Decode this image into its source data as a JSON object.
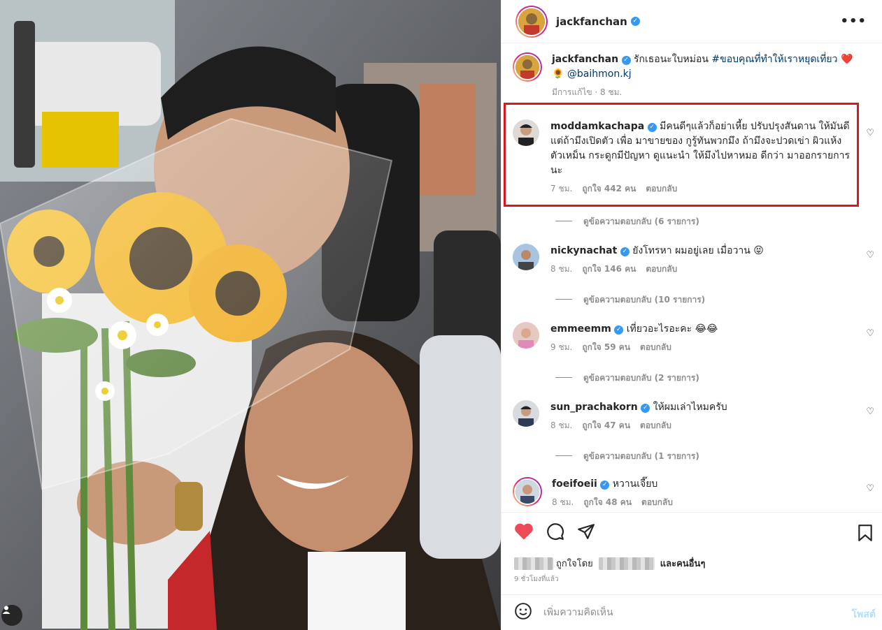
{
  "post": {
    "username": "jackfanchan",
    "caption_user": "jackfanchan",
    "caption_text": "รักเธอนะใบหม่อน",
    "caption_hashtag": "#ขอบคุณที่ทำให้เราหยุดเที่ยว",
    "caption_heart": "❤️",
    "caption_sunflower": "🌻",
    "caption_mention": "@baihmon.kj",
    "caption_meta": "มีการแก้ไข · 8 ชม."
  },
  "comments": [
    {
      "user": "moddamkachapa",
      "text": "มีคนดีๆแล้วก็อย่าเหี้ย ปรับปรุงสันดาน ให้มันดี แต่ถ้ามึงเปิดตัว เพื่อ มาขายของ กูรู้ทันพวกมึง ถ้ามึงจะปวดเข่า ผิวแห้ง ตัวเหม็น กระดูกมีปัญหา ดูแนะนำ ให้มึงไปหาหมอ ดีกว่า มาออกรายการนะ",
      "time": "7 ชม.",
      "likes": "ถูกใจ 442 คน",
      "reply": "ตอบกลับ",
      "view_replies": "ดูข้อความตอบกลับ (6 รายการ)"
    },
    {
      "user": "nickynachat",
      "text": "ยังโทรหา ผมอยู่เลย เมื่อวาน 😝",
      "time": "8 ชม.",
      "likes": "ถูกใจ 146 คน",
      "reply": "ตอบกลับ",
      "view_replies": "ดูข้อความตอบกลับ (10 รายการ)"
    },
    {
      "user": "emmeemm",
      "text": "เที่ยวอะไรอะคะ 😂😂",
      "time": "9 ชม.",
      "likes": "ถูกใจ 59 คน",
      "reply": "ตอบกลับ",
      "view_replies": "ดูข้อความตอบกลับ (2 รายการ)"
    },
    {
      "user": "sun_prachakorn",
      "text": "ให้ผมเล่าไหมครับ",
      "time": "8 ชม.",
      "likes": "ถูกใจ 47 คน",
      "reply": "ตอบกลับ",
      "view_replies": "ดูข้อความตอบกลับ (1 รายการ)"
    },
    {
      "user": "foeifoeii",
      "text": "หวานเจี๊ยบ",
      "time": "8 ชม.",
      "likes": "ถูกใจ 48 คน",
      "reply": "ตอบกลับ"
    }
  ],
  "footer": {
    "liked_by": "ถูกใจโดย",
    "and_others": "และคนอื่นๆ",
    "posted_ago": "9 ชั่วโมงที่แล้ว",
    "add_comment_placeholder": "เพิ่มความคิดเห็น",
    "post_button": "โพสต์"
  },
  "icons": {
    "heart": "heart-icon",
    "comment": "comment-icon",
    "share": "share-icon",
    "save": "bookmark-icon",
    "emoji": "emoji-icon",
    "more": "more-options-icon",
    "tag": "user-tag-icon"
  },
  "colors": {
    "highlight_box": "#d7191f",
    "liked_heart": "#ed4956",
    "verified": "#3897f0",
    "link": "#00376b"
  }
}
